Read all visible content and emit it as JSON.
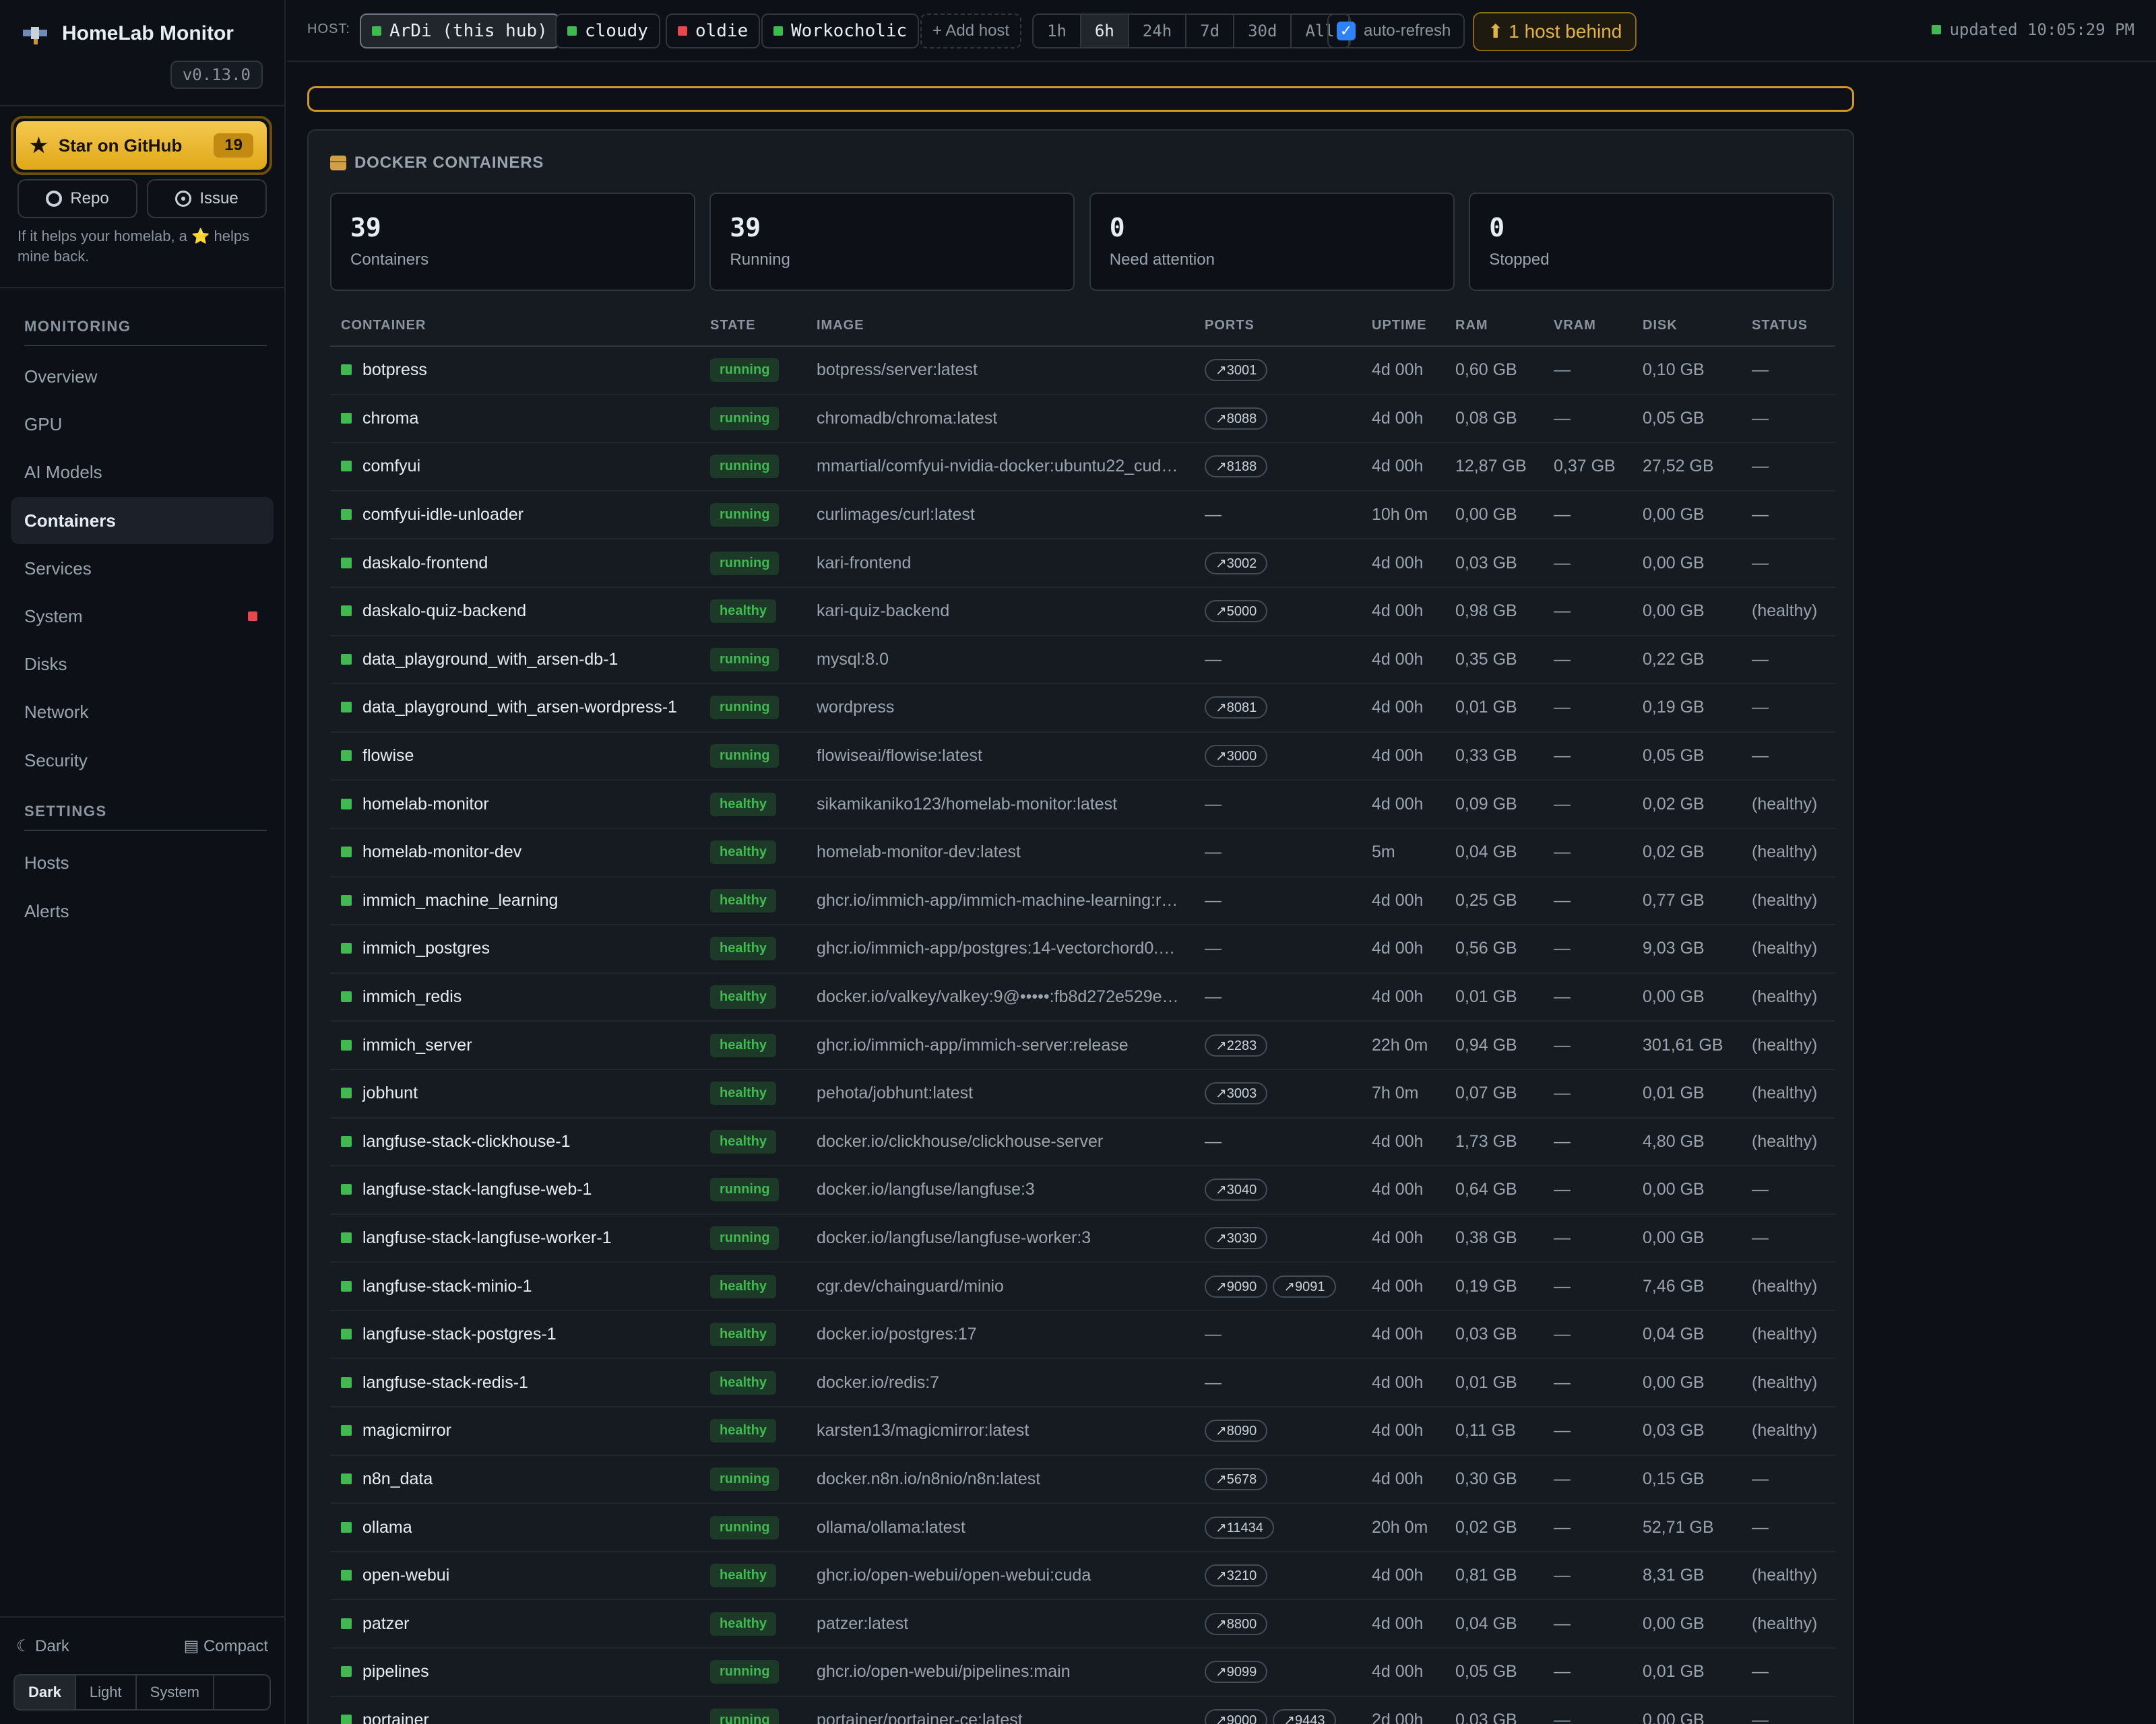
{
  "app": {
    "title": "HomeLab Monitor",
    "version": "v0.13.0"
  },
  "github": {
    "star_label": "Star on GitHub",
    "star_count": "19",
    "repo_label": "Repo",
    "issue_label": "Issue",
    "hint": "If it helps your homelab, a ⭐ helps mine back."
  },
  "sidebar": {
    "monitoring_title": "MONITORING",
    "monitoring": [
      {
        "label": "Overview"
      },
      {
        "label": "GPU"
      },
      {
        "label": "AI Models"
      },
      {
        "label": "Containers",
        "active": true
      },
      {
        "label": "Services"
      },
      {
        "label": "System",
        "alert": true
      },
      {
        "label": "Disks"
      },
      {
        "label": "Network"
      },
      {
        "label": "Security"
      }
    ],
    "settings_title": "SETTINGS",
    "settings": [
      {
        "label": "Hosts"
      },
      {
        "label": "Alerts"
      }
    ],
    "footer": {
      "theme_label": "☾ Dark",
      "compact_label": "▤ Compact",
      "theme_options": [
        "Dark",
        "Light",
        "System"
      ],
      "theme_selected": "Dark"
    }
  },
  "topbar": {
    "host_label": "HOST:",
    "hosts": [
      {
        "name": "ArDi (this hub)",
        "status": "up",
        "selected": true
      },
      {
        "name": "cloudy",
        "status": "up"
      },
      {
        "name": "oldie",
        "status": "down"
      },
      {
        "name": "Workocholic",
        "status": "up"
      }
    ],
    "add_host": "+ Add host",
    "ranges": [
      "1h",
      "6h",
      "24h",
      "7d",
      "30d",
      "All"
    ],
    "range_selected": "6h",
    "auto_refresh_label": "auto-refresh",
    "auto_refresh_checked": true,
    "behind": "⬆ 1 host behind",
    "updated": "updated 10:05:29 PM"
  },
  "colors": {
    "ok": "#3fb950",
    "error": "#e5484d",
    "warn": "#d29922"
  },
  "panel": {
    "title": "DOCKER CONTAINERS",
    "stats": [
      {
        "value": "39",
        "label": "Containers"
      },
      {
        "value": "39",
        "label": "Running"
      },
      {
        "value": "0",
        "label": "Need attention"
      },
      {
        "value": "0",
        "label": "Stopped"
      }
    ],
    "columns": [
      "CONTAINER",
      "STATE",
      "IMAGE",
      "PORTS",
      "UPTIME",
      "RAM",
      "VRAM",
      "DISK",
      "STATUS"
    ],
    "rows": [
      {
        "name": "botpress",
        "state": "running",
        "image": "botpress/server:latest",
        "ports": [
          "↗3001"
        ],
        "uptime": "4d 00h",
        "ram": "0,60 GB",
        "vram": "—",
        "disk": "0,10 GB",
        "status": "—"
      },
      {
        "name": "chroma",
        "state": "running",
        "image": "chromadb/chroma:latest",
        "ports": [
          "↗8088"
        ],
        "uptime": "4d 00h",
        "ram": "0,08 GB",
        "vram": "—",
        "disk": "0,05 GB",
        "status": "—"
      },
      {
        "name": "comfyui",
        "state": "running",
        "image": "mmartial/comfyui-nvidia-docker:ubuntu22_cud…",
        "ports": [
          "↗8188"
        ],
        "uptime": "4d 00h",
        "ram": "12,87 GB",
        "vram": "0,37 GB",
        "disk": "27,52 GB",
        "status": "—"
      },
      {
        "name": "comfyui-idle-unloader",
        "state": "running",
        "image": "curlimages/curl:latest",
        "ports": [],
        "uptime": "10h 0m",
        "ram": "0,00 GB",
        "vram": "—",
        "disk": "0,00 GB",
        "status": "—"
      },
      {
        "name": "daskalo-frontend",
        "state": "running",
        "image": "kari-frontend",
        "ports": [
          "↗3002"
        ],
        "uptime": "4d 00h",
        "ram": "0,03 GB",
        "vram": "—",
        "disk": "0,00 GB",
        "status": "—"
      },
      {
        "name": "daskalo-quiz-backend",
        "state": "healthy",
        "image": "kari-quiz-backend",
        "ports": [
          "↗5000"
        ],
        "uptime": "4d 00h",
        "ram": "0,98 GB",
        "vram": "—",
        "disk": "0,00 GB",
        "status": "(healthy)"
      },
      {
        "name": "data_playground_with_arsen-db-1",
        "state": "running",
        "image": "mysql:8.0",
        "ports": [],
        "uptime": "4d 00h",
        "ram": "0,35 GB",
        "vram": "—",
        "disk": "0,22 GB",
        "status": "—"
      },
      {
        "name": "data_playground_with_arsen-wordpress-1",
        "state": "running",
        "image": "wordpress",
        "ports": [
          "↗8081"
        ],
        "uptime": "4d 00h",
        "ram": "0,01 GB",
        "vram": "—",
        "disk": "0,19 GB",
        "status": "—"
      },
      {
        "name": "flowise",
        "state": "running",
        "image": "flowiseai/flowise:latest",
        "ports": [
          "↗3000"
        ],
        "uptime": "4d 00h",
        "ram": "0,33 GB",
        "vram": "—",
        "disk": "0,05 GB",
        "status": "—"
      },
      {
        "name": "homelab-monitor",
        "state": "healthy",
        "image": "sikamikaniko123/homelab-monitor:latest",
        "ports": [],
        "uptime": "4d 00h",
        "ram": "0,09 GB",
        "vram": "—",
        "disk": "0,02 GB",
        "status": "(healthy)"
      },
      {
        "name": "homelab-monitor-dev",
        "state": "healthy",
        "image": "homelab-monitor-dev:latest",
        "ports": [],
        "uptime": "5m",
        "ram": "0,04 GB",
        "vram": "—",
        "disk": "0,02 GB",
        "status": "(healthy)"
      },
      {
        "name": "immich_machine_learning",
        "state": "healthy",
        "image": "ghcr.io/immich-app/immich-machine-learning:r…",
        "ports": [],
        "uptime": "4d 00h",
        "ram": "0,25 GB",
        "vram": "—",
        "disk": "0,77 GB",
        "status": "(healthy)"
      },
      {
        "name": "immich_postgres",
        "state": "healthy",
        "image": "ghcr.io/immich-app/postgres:14-vectorchord0.…",
        "ports": [],
        "uptime": "4d 00h",
        "ram": "0,56 GB",
        "vram": "—",
        "disk": "9,03 GB",
        "status": "(healthy)"
      },
      {
        "name": "immich_redis",
        "state": "healthy",
        "image": "docker.io/valkey/valkey:9@•••••:fb8d272e529e…",
        "ports": [],
        "uptime": "4d 00h",
        "ram": "0,01 GB",
        "vram": "—",
        "disk": "0,00 GB",
        "status": "(healthy)"
      },
      {
        "name": "immich_server",
        "state": "healthy",
        "image": "ghcr.io/immich-app/immich-server:release",
        "ports": [
          "↗2283"
        ],
        "uptime": "22h 0m",
        "ram": "0,94 GB",
        "vram": "—",
        "disk": "301,61 GB",
        "status": "(healthy)"
      },
      {
        "name": "jobhunt",
        "state": "healthy",
        "image": "pehota/jobhunt:latest",
        "ports": [
          "↗3003"
        ],
        "uptime": "7h 0m",
        "ram": "0,07 GB",
        "vram": "—",
        "disk": "0,01 GB",
        "status": "(healthy)"
      },
      {
        "name": "langfuse-stack-clickhouse-1",
        "state": "healthy",
        "image": "docker.io/clickhouse/clickhouse-server",
        "ports": [],
        "uptime": "4d 00h",
        "ram": "1,73 GB",
        "vram": "—",
        "disk": "4,80 GB",
        "status": "(healthy)"
      },
      {
        "name": "langfuse-stack-langfuse-web-1",
        "state": "running",
        "image": "docker.io/langfuse/langfuse:3",
        "ports": [
          "↗3040"
        ],
        "uptime": "4d 00h",
        "ram": "0,64 GB",
        "vram": "—",
        "disk": "0,00 GB",
        "status": "—"
      },
      {
        "name": "langfuse-stack-langfuse-worker-1",
        "state": "running",
        "image": "docker.io/langfuse/langfuse-worker:3",
        "ports": [
          "↗3030"
        ],
        "uptime": "4d 00h",
        "ram": "0,38 GB",
        "vram": "—",
        "disk": "0,00 GB",
        "status": "—"
      },
      {
        "name": "langfuse-stack-minio-1",
        "state": "healthy",
        "image": "cgr.dev/chainguard/minio",
        "ports": [
          "↗9090",
          "↗9091"
        ],
        "uptime": "4d 00h",
        "ram": "0,19 GB",
        "vram": "—",
        "disk": "7,46 GB",
        "status": "(healthy)"
      },
      {
        "name": "langfuse-stack-postgres-1",
        "state": "healthy",
        "image": "docker.io/postgres:17",
        "ports": [],
        "uptime": "4d 00h",
        "ram": "0,03 GB",
        "vram": "—",
        "disk": "0,04 GB",
        "status": "(healthy)"
      },
      {
        "name": "langfuse-stack-redis-1",
        "state": "healthy",
        "image": "docker.io/redis:7",
        "ports": [],
        "uptime": "4d 00h",
        "ram": "0,01 GB",
        "vram": "—",
        "disk": "0,00 GB",
        "status": "(healthy)"
      },
      {
        "name": "magicmirror",
        "state": "healthy",
        "image": "karsten13/magicmirror:latest",
        "ports": [
          "↗8090"
        ],
        "uptime": "4d 00h",
        "ram": "0,11 GB",
        "vram": "—",
        "disk": "0,03 GB",
        "status": "(healthy)"
      },
      {
        "name": "n8n_data",
        "state": "running",
        "image": "docker.n8n.io/n8nio/n8n:latest",
        "ports": [
          "↗5678"
        ],
        "uptime": "4d 00h",
        "ram": "0,30 GB",
        "vram": "—",
        "disk": "0,15 GB",
        "status": "—"
      },
      {
        "name": "ollama",
        "state": "running",
        "image": "ollama/ollama:latest",
        "ports": [
          "↗11434"
        ],
        "uptime": "20h 0m",
        "ram": "0,02 GB",
        "vram": "—",
        "disk": "52,71 GB",
        "status": "—"
      },
      {
        "name": "open-webui",
        "state": "healthy",
        "image": "ghcr.io/open-webui/open-webui:cuda",
        "ports": [
          "↗3210"
        ],
        "uptime": "4d 00h",
        "ram": "0,81 GB",
        "vram": "—",
        "disk": "8,31 GB",
        "status": "(healthy)"
      },
      {
        "name": "patzer",
        "state": "healthy",
        "image": "patzer:latest",
        "ports": [
          "↗8800"
        ],
        "uptime": "4d 00h",
        "ram": "0,04 GB",
        "vram": "—",
        "disk": "0,00 GB",
        "status": "(healthy)"
      },
      {
        "name": "pipelines",
        "state": "running",
        "image": "ghcr.io/open-webui/pipelines:main",
        "ports": [
          "↗9099"
        ],
        "uptime": "4d 00h",
        "ram": "0,05 GB",
        "vram": "—",
        "disk": "0,01 GB",
        "status": "—"
      },
      {
        "name": "portainer",
        "state": "running",
        "image": "portainer/portainer-ce:latest",
        "ports": [
          "↗9000",
          "↗9443"
        ],
        "uptime": "2d 00h",
        "ram": "0,03 GB",
        "vram": "—",
        "disk": "0,00 GB",
        "status": "—"
      }
    ]
  }
}
